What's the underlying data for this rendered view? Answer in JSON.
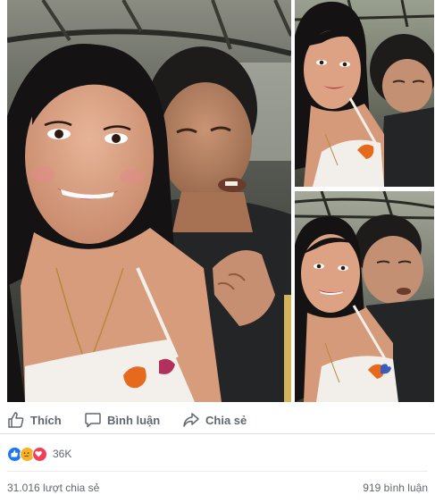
{
  "post": {
    "photos": [
      {
        "name": "photo-main",
        "description": ""
      },
      {
        "name": "photo-top-right",
        "description": ""
      },
      {
        "name": "photo-bottom-right",
        "description": ""
      }
    ]
  },
  "actions": {
    "like_label": "Thích",
    "comment_label": "Bình luận",
    "share_label": "Chia sẻ",
    "icons": {
      "like": "thumbs-up-icon",
      "comment": "speech-bubble-icon",
      "share": "share-arrow-icon"
    }
  },
  "reactions": {
    "icons": [
      "like-reaction-icon",
      "sad-reaction-icon",
      "love-reaction-icon"
    ],
    "colors": {
      "like": "#1877f2",
      "sad": "#f7b125",
      "love": "#f33e58"
    },
    "count": "36K"
  },
  "stats": {
    "shares": "31.016 lượt chia sẻ",
    "comments": "919 bình luận"
  },
  "theme": {
    "text_muted": "#606770",
    "divider": "#dddfe2"
  }
}
